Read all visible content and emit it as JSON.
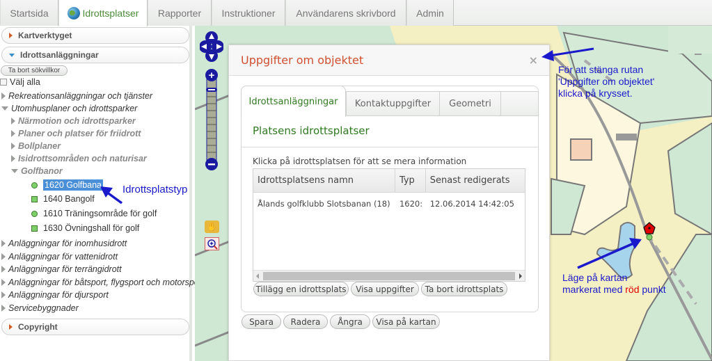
{
  "top_tabs": [
    {
      "label": "Startsida",
      "active": false
    },
    {
      "label": "Idrottsplatser",
      "active": true,
      "icon": "globe-icon"
    },
    {
      "label": "Rapporter",
      "active": false
    },
    {
      "label": "Instruktioner",
      "active": false
    },
    {
      "label": "Användarens skrivbord",
      "active": false
    },
    {
      "label": "Admin",
      "active": false
    }
  ],
  "sidebar": {
    "sections": {
      "kartverktyget": "Kartverktyget",
      "idrottsanlaggningar": "Idrottsanläggningar",
      "copyright": "Copyright"
    },
    "clear_filter_button": "Ta bort sökvillkor",
    "select_all_label": "Välj alla",
    "tree": [
      {
        "label": "Rekreationsanläggningar och tjänster",
        "expanded": false
      },
      {
        "label": "Utomhusplaner och idrottsparker",
        "expanded": true
      },
      {
        "label": "Närmotion och idrottsparker",
        "expanded": false
      },
      {
        "label": "Planer och platser för friidrott",
        "expanded": false
      },
      {
        "label": "Bollplaner",
        "expanded": false
      },
      {
        "label": "Isidrottsområden och naturisar",
        "expanded": false
      },
      {
        "label": "Golfbanor",
        "expanded": true
      },
      {
        "label": "Anläggningar för inomhusidrott",
        "expanded": false
      },
      {
        "label": "Anläggningar för vattenidrott",
        "expanded": false
      },
      {
        "label": "Anläggningar för terrängidrott",
        "expanded": false
      },
      {
        "label": "Anläggningar för båtsport, flygsport och motorspo",
        "expanded": false
      },
      {
        "label": "Anläggningar för djursport",
        "expanded": false
      },
      {
        "label": "Servicebyggnader",
        "expanded": false
      }
    ],
    "golf_leaves": [
      {
        "label": "1620 Golfbana",
        "symbol": "circle",
        "selected": true
      },
      {
        "label": "1640 Bangolf",
        "symbol": "square",
        "selected": false
      },
      {
        "label": "1610 Träningsområde för golf",
        "symbol": "circle",
        "selected": false
      },
      {
        "label": "1630 Övningshall för golf",
        "symbol": "square",
        "selected": false
      }
    ]
  },
  "annotations": {
    "type_label": "Idrottsplatstyp",
    "close_hint": [
      "För att stänga rutan",
      "'Uppgifter om objektet'",
      "klicka på krysset."
    ],
    "location_hint_line1": "Läge på kartan",
    "location_hint_line2_a": "markerat med ",
    "location_hint_line2_red": "röd",
    "location_hint_line2_b": " punkt"
  },
  "dialog": {
    "title": "Uppgifter om objektet",
    "close_symbol": "×",
    "tabs": [
      {
        "label": "Idrottsanläggningar",
        "active": true
      },
      {
        "label": "Kontaktuppgifter",
        "active": false
      },
      {
        "label": "Geometri",
        "active": false
      }
    ],
    "section_title": "Platsens idrottsplatser",
    "hint": "Klicka på idrottsplatsen för att se mera information",
    "table": {
      "columns": [
        "Idrottsplatsens namn",
        "Typ",
        "Senast redigerats"
      ],
      "rows": [
        [
          "Ålands golfklubb Slotsbanan (18)",
          "1620: ",
          "12.06.2014 14:42:05"
        ]
      ]
    },
    "table_buttons": [
      "Tillägg en idrottsplats",
      "Visa uppgifter",
      "Ta bort idrottsplats"
    ],
    "footer_buttons": [
      "Spara",
      "Radera",
      "Ångra",
      "Visa på kartan"
    ]
  },
  "colors": {
    "accent_green": "#2f7a20",
    "dialog_title": "#d05030",
    "annotation_blue": "#1a1acc",
    "marker_red": "#e00000"
  }
}
